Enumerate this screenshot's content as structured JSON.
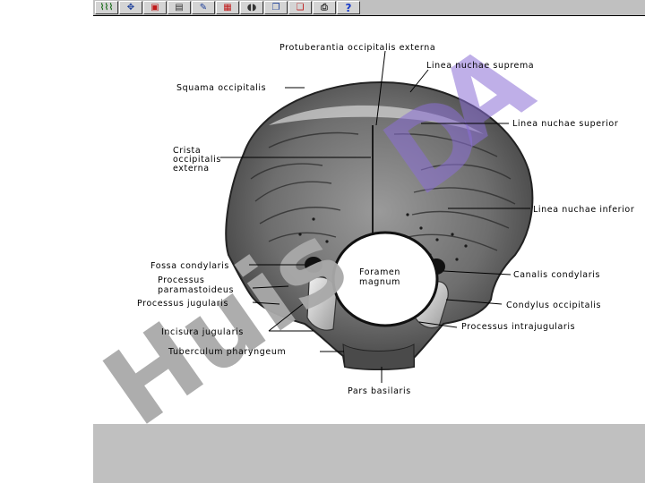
{
  "toolbar": {
    "buttons": [
      {
        "name": "waveform-button",
        "glyph": "⌇⌇⌇",
        "color": "#1d6f1d"
      },
      {
        "name": "move-arrows-button",
        "glyph": "✥",
        "color": "#1d3f9a"
      },
      {
        "name": "image-button",
        "glyph": "▣",
        "color": "#c01818"
      },
      {
        "name": "document-button",
        "glyph": "▤",
        "color": "#333333"
      },
      {
        "name": "tools-button",
        "glyph": "✎",
        "color": "#1d3f9a"
      },
      {
        "name": "gallery-button",
        "glyph": "▦",
        "color": "#c01818"
      },
      {
        "name": "sound-button",
        "glyph": "◖◗",
        "color": "#333333"
      },
      {
        "name": "copy-button",
        "glyph": "❐",
        "color": "#1d3f9a"
      },
      {
        "name": "bookmark-button",
        "glyph": "❏",
        "color": "#c01818"
      },
      {
        "name": "print-button",
        "glyph": "⎙",
        "color": "#333333"
      },
      {
        "name": "help-button",
        "glyph": "?",
        "color": "#1a3cc8"
      }
    ]
  },
  "labels": {
    "protuberantia": "Protuberantia occipitalis externa",
    "linea_suprema": "Linea nuchae suprema",
    "squama": "Squama occipitalis",
    "linea_superior": "Linea nuchae  superior",
    "crista_1": "Crista",
    "crista_2": "occipitalis",
    "crista_3": "externa",
    "linea_inferior": "Linea nuchae inferior",
    "fossa": "Fossa condylaris",
    "foramen_1": "Foramen",
    "foramen_2": "magnum",
    "canalis": "Canalis condylaris",
    "proc_paramast_1": "Processus",
    "proc_paramast_2": "paramastoideus",
    "condylus": "Condylus occipitalis",
    "proc_jugularis": "Processus jugularis",
    "proc_intrajug": "Processus intrajugularis",
    "incisura": "Incisura   jugularis",
    "tuberculum": "Tuberculum pharyngeum",
    "pars_basilaris": "Pars basilaris"
  },
  "watermark": {
    "text": "Huis",
    "letter_a": "A",
    "letter_d": "D",
    "gray_color": "#a9a9a9",
    "purple_color": "#8b6fd6"
  }
}
